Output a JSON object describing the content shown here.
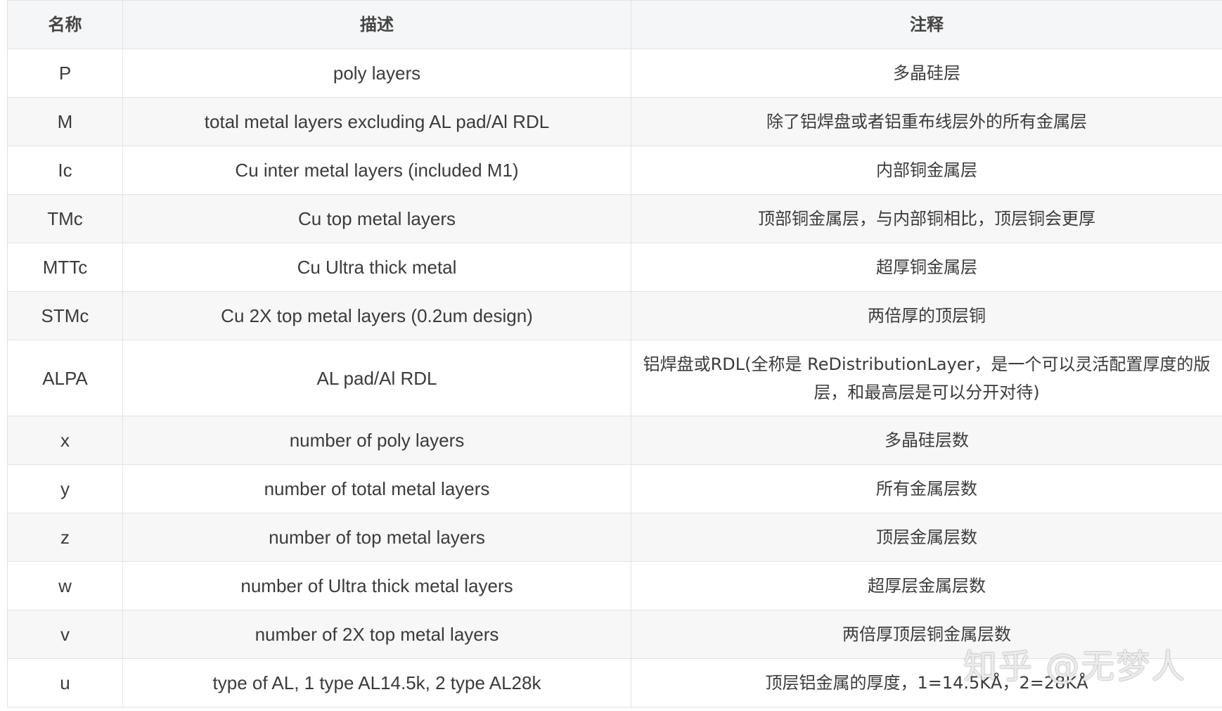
{
  "headers": {
    "name": "名称",
    "description": "描述",
    "note": "注释"
  },
  "rows": [
    {
      "name": "P",
      "description": "poly layers",
      "note": "多晶硅层"
    },
    {
      "name": "M",
      "description": "total metal layers excluding AL pad/Al RDL",
      "note": "除了铝焊盘或者铝重布线层外的所有金属层"
    },
    {
      "name": "Ic",
      "description": "Cu inter metal layers (included M1)",
      "note": "内部铜金属层"
    },
    {
      "name": "TMc",
      "description": "Cu top metal layers",
      "note": "顶部铜金属层，与内部铜相比，顶层铜会更厚"
    },
    {
      "name": "MTTc",
      "description": "Cu Ultra thick metal",
      "note": "超厚铜金属层"
    },
    {
      "name": "STMc",
      "description": "Cu 2X top metal layers (0.2um design)",
      "note": "两倍厚的顶层铜"
    },
    {
      "name": "ALPA",
      "description": "AL pad/Al RDL",
      "note": "铝焊盘或RDL(全称是 ReDistributionLayer，是一个可以灵活配置厚度的版层，和最高层是可以分开对待)"
    },
    {
      "name": "x",
      "description": "number of poly layers",
      "note": "多晶硅层数"
    },
    {
      "name": "y",
      "description": "number of total metal layers",
      "note": "所有金属层数"
    },
    {
      "name": "z",
      "description": "number of top metal layers",
      "note": "顶层金属层数"
    },
    {
      "name": "w",
      "description": "number of Ultra thick metal layers",
      "note": "超厚层金属层数"
    },
    {
      "name": "v",
      "description": "number of 2X top metal layers",
      "note": "两倍厚顶层铜金属层数"
    },
    {
      "name": "u",
      "description": "type of AL, 1 type AL14.5k, 2 type AL28k",
      "note": "顶层铝金属的厚度，1=14.5KÅ，2=28KÅ"
    }
  ],
  "watermark": "知乎 @无梦人"
}
